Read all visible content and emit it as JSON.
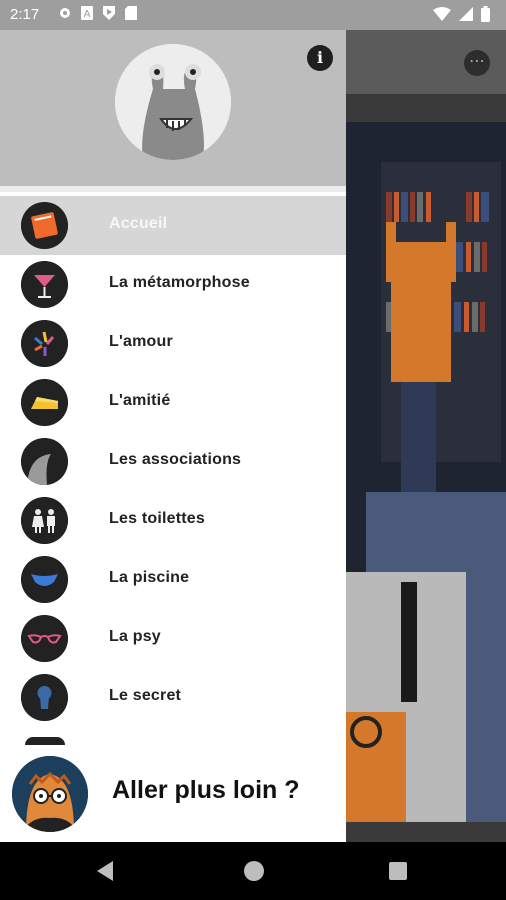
{
  "status_bar": {
    "time": "2:17",
    "left_icons": [
      "gear-icon",
      "a-icon",
      "play-shield-icon",
      "sd-card-icon"
    ],
    "right_icons": [
      "wifi-icon",
      "signal-icon",
      "battery-icon"
    ]
  },
  "drawer": {
    "info_icon_glyph": "i",
    "items": [
      {
        "label": "Accueil",
        "icon": "book-icon"
      },
      {
        "label": "La métamorphose",
        "icon": "cocktail-glass-icon"
      },
      {
        "label": "L'amour",
        "icon": "sparkle-icon"
      },
      {
        "label": "L'amitié",
        "icon": "cheese-icon"
      },
      {
        "label": "Les associations",
        "icon": "tentacle-icon"
      },
      {
        "label": "Les toilettes",
        "icon": "restroom-icon"
      },
      {
        "label": "La piscine",
        "icon": "swimsuit-icon"
      },
      {
        "label": "La psy",
        "icon": "glasses-icon"
      },
      {
        "label": "Le secret",
        "icon": "keyhole-icon"
      }
    ],
    "footer": {
      "label": "Aller plus loin ?"
    }
  },
  "background": {
    "more_glyph": "⋯"
  },
  "colors": {
    "header_gray": "#bdbdbd",
    "selected_gray": "#d6d6d6",
    "status_gray": "#9e9e9e"
  }
}
